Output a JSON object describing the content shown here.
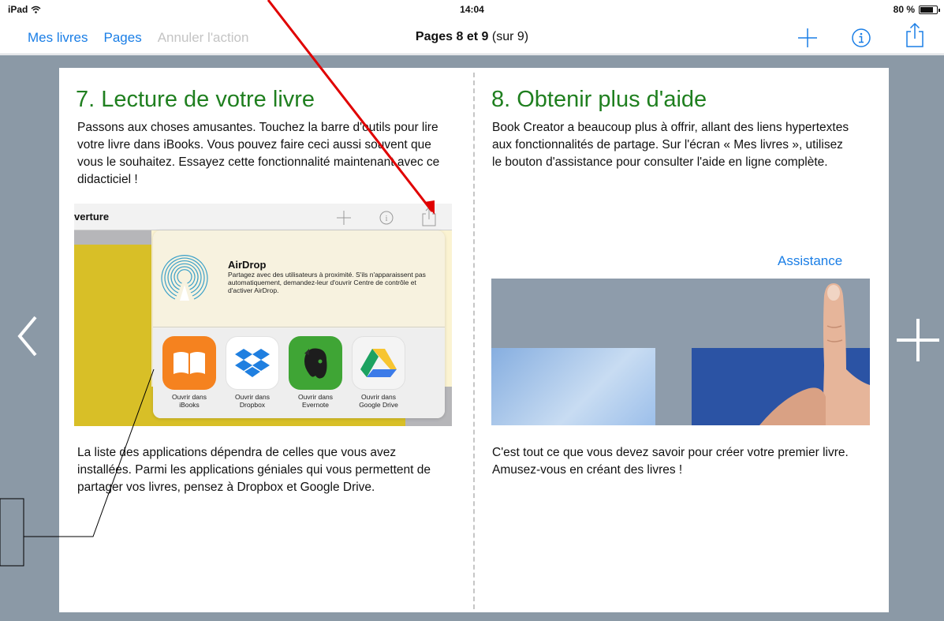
{
  "status_bar": {
    "carrier": "iPad",
    "time": "14:04",
    "battery": "80 %",
    "battery_level": 0.8
  },
  "toolbar": {
    "my_books": "Mes livres",
    "pages": "Pages",
    "undo": "Annuler l'action",
    "title_bold": "Pages 8 et 9",
    "title_rest": "(sur 9)"
  },
  "left_page": {
    "heading": "7. Lecture de votre livre",
    "intro": "Passons aux choses amusantes. Touchez la barre d'outils pour lire votre livre dans iBooks. Vous pouvez faire ceci aussi souvent que vous le souhaitez. Essayez cette fonctionnalité maintenant avec ce didacticiel !",
    "footer": "La liste des applications dépendra de celles que vous avez installées. Parmi les applications géniales qui vous permettent de partager vos livres, pensez à Dropbox et Google Drive.",
    "illustration": {
      "bar_title": "verture",
      "airdrop_title": "AirDrop",
      "airdrop_desc": "Partagez avec des utilisateurs à proximité. S'ils n'apparaissent pas automatiquement, demandez-leur d'ouvrir Centre de contrôle et d'activer AirDrop.",
      "apps": [
        {
          "label": "Ouvrir dans iBooks",
          "icon": "ibooks-icon",
          "color": "#f5821f"
        },
        {
          "label": "Ouvrir dans Dropbox",
          "icon": "dropbox-icon",
          "color": "#ffffff"
        },
        {
          "label": "Ouvrir dans Evernote",
          "icon": "evernote-icon",
          "color": "#3fa535"
        },
        {
          "label": "Ouvrir dans Google Drive",
          "icon": "google-drive-icon",
          "color": "#f4f4f4"
        }
      ]
    }
  },
  "right_page": {
    "heading": "8. Obtenir plus d'aide",
    "intro": "Book Creator a beaucoup plus à offrir, allant des liens hypertextes aux fonctionnalités de partage. Sur l'écran « Mes livres », utilisez le bouton d'assistance pour consulter l'aide en ligne complète.",
    "help_link": "Assistance",
    "footer": "C'est tout ce que vous devez savoir pour créer votre premier livre. Amusez-vous en créant des livres !"
  },
  "colors": {
    "accent": "#1a7ee6",
    "heading": "#1f7f1f",
    "canvas": "#8b99a6",
    "annotation": "#e00000"
  }
}
